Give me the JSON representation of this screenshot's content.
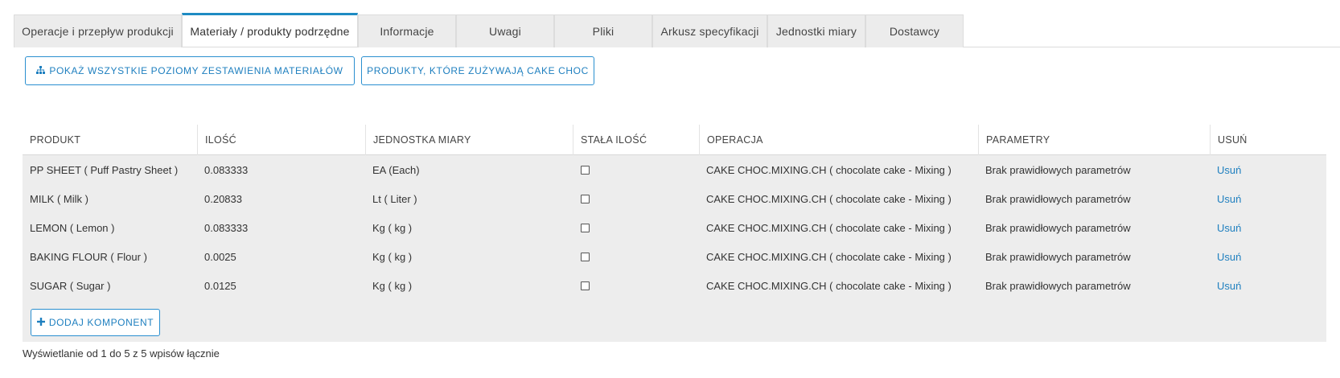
{
  "tabs": [
    {
      "label": "Operacje i przepływ produkcji",
      "active": false
    },
    {
      "label": "Materiały / produkty podrzędne",
      "active": true
    },
    {
      "label": "Informacje",
      "active": false
    },
    {
      "label": "Uwagi",
      "active": false
    },
    {
      "label": "Pliki",
      "active": false
    },
    {
      "label": "Arkusz specyfikacji",
      "active": false
    },
    {
      "label": "Jednostki miary",
      "active": false
    },
    {
      "label": "Dostawcy",
      "active": false
    }
  ],
  "actions": {
    "show_all_levels": "POKAŻ WSZYSTKIE POZIOMY ZESTAWIENIA MATERIAŁÓW",
    "products_using": "PRODUKTY, KTÓRE ZUŻYWAJĄ CAKE CHOC",
    "add_component": "DODAJ KOMPONENT"
  },
  "table": {
    "headers": [
      "PRODUKT",
      "ILOŚĆ",
      "JEDNOSTKA MIARY",
      "STAŁA ILOŚĆ",
      "OPERACJA",
      "PARAMETRY",
      "USUŃ"
    ],
    "rows": [
      {
        "product": "PP SHEET ( Puff Pastry Sheet )",
        "qty": "0.083333",
        "unit": "EA (Each)",
        "fixed": false,
        "operation": "CAKE CHOC.MIXING.CH ( chocolate cake - Mixing )",
        "params": "Brak prawidłowych parametrów",
        "remove": "Usuń"
      },
      {
        "product": "MILK ( Milk )",
        "qty": "0.20833",
        "unit": "Lt ( Liter )",
        "fixed": false,
        "operation": "CAKE CHOC.MIXING.CH ( chocolate cake - Mixing )",
        "params": "Brak prawidłowych parametrów",
        "remove": "Usuń"
      },
      {
        "product": "LEMON ( Lemon )",
        "qty": "0.083333",
        "unit": "Kg ( kg )",
        "fixed": false,
        "operation": "CAKE CHOC.MIXING.CH ( chocolate cake - Mixing )",
        "params": "Brak prawidłowych parametrów",
        "remove": "Usuń"
      },
      {
        "product": "BAKING FLOUR ( Flour )",
        "qty": "0.0025",
        "unit": "Kg ( kg )",
        "fixed": false,
        "operation": "CAKE CHOC.MIXING.CH ( chocolate cake - Mixing )",
        "params": "Brak prawidłowych parametrów",
        "remove": "Usuń"
      },
      {
        "product": "SUGAR ( Sugar )",
        "qty": "0.0125",
        "unit": "Kg ( kg )",
        "fixed": false,
        "operation": "CAKE CHOC.MIXING.CH ( chocolate cake - Mixing )",
        "params": "Brak prawidłowych parametrów",
        "remove": "Usuń"
      }
    ]
  },
  "footer": {
    "info": "Wyświetlanie od 1 do 5 z 5 wpisów łącznie"
  },
  "icons": {
    "hierarchy": "sitemap-icon",
    "plus": "plus-icon"
  },
  "colors": {
    "accent": "#1e8bc3",
    "link": "#1e7fbf",
    "row_bg": "#ededed",
    "tab_bg": "#ececec"
  }
}
